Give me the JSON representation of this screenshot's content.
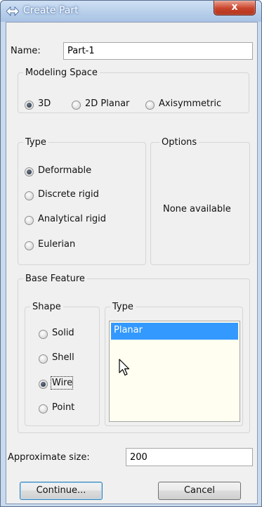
{
  "window": {
    "title": "Create Part",
    "close_symbol": "x"
  },
  "name_row": {
    "label": "Name:",
    "value": "Part-1"
  },
  "modeling_space": {
    "legend": "Modeling Space",
    "options": [
      {
        "label": "3D",
        "checked": true
      },
      {
        "label": "2D Planar",
        "checked": false
      },
      {
        "label": "Axisymmetric",
        "checked": false
      }
    ]
  },
  "type_group": {
    "legend": "Type",
    "options": [
      {
        "label": "Deformable",
        "checked": true
      },
      {
        "label": "Discrete rigid",
        "checked": false
      },
      {
        "label": "Analytical rigid",
        "checked": false
      },
      {
        "label": "Eulerian",
        "checked": false
      }
    ]
  },
  "options_group": {
    "legend": "Options",
    "text": "None available"
  },
  "base_feature": {
    "legend": "Base Feature",
    "shape": {
      "legend": "Shape",
      "options": [
        {
          "label": "Solid",
          "checked": false
        },
        {
          "label": "Shell",
          "checked": false
        },
        {
          "label": "Wire",
          "checked": true
        },
        {
          "label": "Point",
          "checked": false
        }
      ]
    },
    "type": {
      "legend": "Type",
      "items": [
        "Planar"
      ],
      "selected": "Planar"
    }
  },
  "approx_size": {
    "label": "Approximate size:",
    "value": "200"
  },
  "buttons": {
    "continue_label": "Continue...",
    "cancel_label": "Cancel"
  },
  "colors": {
    "selection": "#3399ff",
    "list_background": "#fffef0",
    "close_button": "#c8442c"
  }
}
